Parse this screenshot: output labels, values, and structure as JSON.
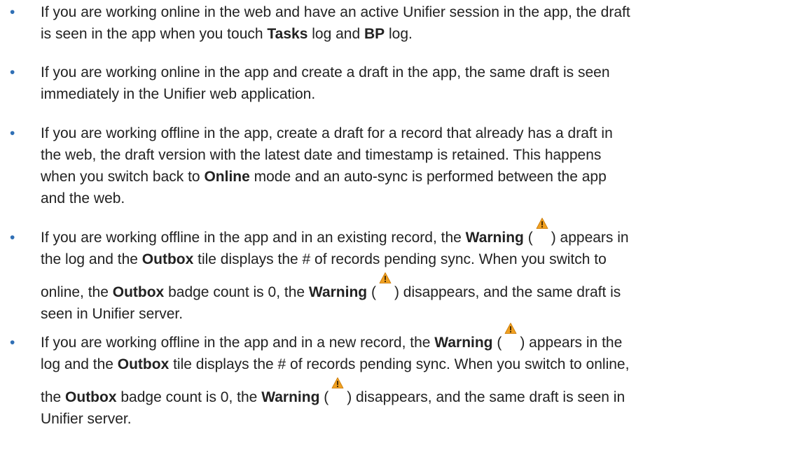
{
  "bullet_char": "•",
  "icons": {
    "warning": "warning-triangle-icon",
    "warning_color": "#f0a020"
  },
  "items": [
    {
      "lines": [
        [
          "If you are working online in the web and have an active Unifier session in the app, the draft"
        ],
        [
          "is seen in the app when you touch ",
          {
            "b": "Tasks"
          },
          " log and ",
          {
            "b": "BP"
          },
          " log."
        ]
      ]
    },
    {
      "lines": [
        [
          "If you are working online in the app and create a draft in the app, the same draft is seen"
        ],
        [
          "immediately in the Unifier web application."
        ]
      ]
    },
    {
      "lines": [
        [
          "If you are working offline in the app, create a draft for a record that already has a draft in"
        ],
        [
          "the web, the draft version with the latest date and timestamp is retained. This happens"
        ],
        [
          "when you switch back to ",
          {
            "b": "Online"
          },
          " mode and an auto-sync is performed between the app"
        ],
        [
          "and the web."
        ]
      ]
    },
    {
      "lines": [
        [
          "If you are working offline in the app and in an existing record, the ",
          {
            "b": "Warning"
          },
          " (",
          {
            "icon": "warning"
          },
          ") appears in"
        ],
        [
          "the log and the ",
          {
            "b": "Outbox"
          },
          " tile displays the # of records pending sync. When you switch to"
        ],
        [
          "online, the ",
          {
            "b": "Outbox"
          },
          " badge count is 0, the ",
          {
            "b": "Warning"
          },
          " (",
          {
            "icon": "warning"
          },
          ") disappears, and the same draft is"
        ],
        [
          "seen in Unifier server."
        ]
      ]
    },
    {
      "lines": [
        [
          "If you are working offline in the app and in a new record, the ",
          {
            "b": "Warning"
          },
          " (",
          {
            "icon": "warning"
          },
          ") appears in the"
        ],
        [
          "log and the ",
          {
            "b": "Outbox"
          },
          " tile displays the # of records pending sync. When you switch to online,"
        ],
        [
          "the ",
          {
            "b": "Outbox"
          },
          " badge count is 0, the ",
          {
            "b": "Warning"
          },
          " (",
          {
            "icon": "warning"
          },
          ") disappears, and the same draft is seen in"
        ],
        [
          "Unifier server."
        ]
      ]
    }
  ]
}
